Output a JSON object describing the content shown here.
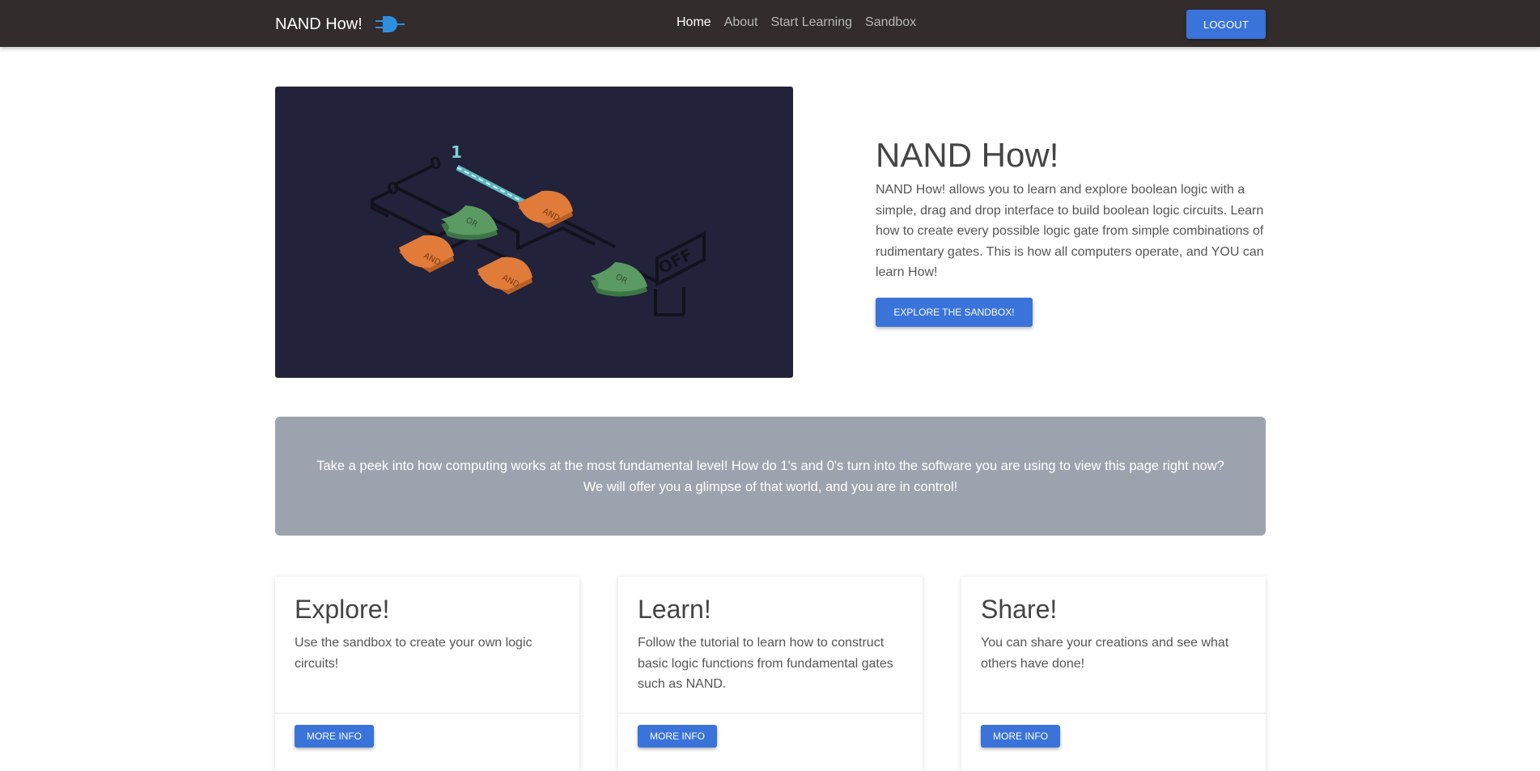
{
  "navbar": {
    "brand": "NAND How!",
    "links": [
      {
        "label": "Home",
        "active": true
      },
      {
        "label": "About",
        "active": false
      },
      {
        "label": "Start Learning",
        "active": false
      },
      {
        "label": "Sandbox",
        "active": false
      }
    ],
    "logout_label": "LOGOUT"
  },
  "hero": {
    "title": "NAND How!",
    "description": "NAND How! allows you to learn and explore boolean logic with a simple, drag and drop interface to build boolean logic circuits. Learn how to create every possible logic gate from simple combinations of rudimentary gates. This is how all computers operate, and YOU can learn How!",
    "button_label": "EXPLORE THE SANDBOX!",
    "illustration": {
      "inputs": [
        "0",
        "0",
        "1"
      ],
      "gates": [
        "AND",
        "OR",
        "AND",
        "AND",
        "OR"
      ],
      "output_label": "OFF"
    }
  },
  "banner": {
    "text": "Take a peek into how computing works at the most fundamental level! How do 1's and 0's turn into the software you are using to view this page right now? We will offer you a glimpse of that world, and you are in control!"
  },
  "cards": [
    {
      "title": "Explore!",
      "text": "Use the sandbox to create your own logic circuits!",
      "button_label": "MORE INFO"
    },
    {
      "title": "Learn!",
      "text": "Follow the tutorial to learn how to construct basic logic functions from fundamental gates such as NAND.",
      "button_label": "MORE INFO"
    },
    {
      "title": "Share!",
      "text": "You can share your creations and see what others have done!",
      "button_label": "MORE INFO"
    }
  ],
  "colors": {
    "navbar_bg": "#332c2c",
    "accent": "#3a73d9",
    "hero_bg": "#22223b",
    "banner_bg": "#9da3ae",
    "and_gate": "#e07b3a",
    "or_gate": "#5b9a63",
    "active_wire": "#7fd0d4"
  }
}
